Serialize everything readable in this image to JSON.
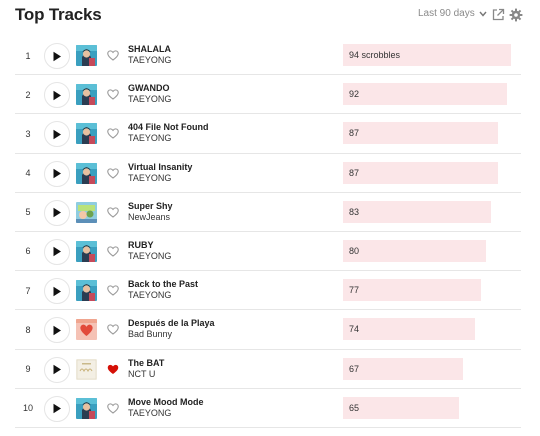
{
  "header": {
    "title": "Top Tracks",
    "period_label": "Last 90 days",
    "period_icon": "chevron-down-icon",
    "share_icon": "share-icon",
    "settings_icon": "gear-icon"
  },
  "colors": {
    "bar_fill": "#fbe6e8",
    "loved_heart": "#d51007",
    "text_primary": "#222222",
    "text_muted": "#8a8a8a"
  },
  "tracks": [
    {
      "rank": "1",
      "title": "SHALALA",
      "artist": "TAEYONG",
      "scrobbles": "94 scrobbles",
      "count": 94,
      "loved": false,
      "art": "taeyong"
    },
    {
      "rank": "2",
      "title": "GWANDO",
      "artist": "TAEYONG",
      "scrobbles": "92",
      "count": 92,
      "loved": false,
      "art": "taeyong"
    },
    {
      "rank": "3",
      "title": "404 File Not Found",
      "artist": "TAEYONG",
      "scrobbles": "87",
      "count": 87,
      "loved": false,
      "art": "taeyong"
    },
    {
      "rank": "4",
      "title": "Virtual Insanity",
      "artist": "TAEYONG",
      "scrobbles": "87",
      "count": 87,
      "loved": false,
      "art": "taeyong"
    },
    {
      "rank": "5",
      "title": "Super Shy",
      "artist": "NewJeans",
      "scrobbles": "83",
      "count": 83,
      "loved": false,
      "art": "newjeans"
    },
    {
      "rank": "6",
      "title": "RUBY",
      "artist": "TAEYONG",
      "scrobbles": "80",
      "count": 80,
      "loved": false,
      "art": "taeyong"
    },
    {
      "rank": "7",
      "title": "Back to the Past",
      "artist": "TAEYONG",
      "scrobbles": "77",
      "count": 77,
      "loved": false,
      "art": "taeyong"
    },
    {
      "rank": "8",
      "title": "Después de la Playa",
      "artist": "Bad Bunny",
      "scrobbles": "74",
      "count": 74,
      "loved": false,
      "art": "badbunny"
    },
    {
      "rank": "9",
      "title": "The BAT",
      "artist": "NCT U",
      "scrobbles": "67",
      "count": 67,
      "loved": true,
      "art": "nctu"
    },
    {
      "rank": "10",
      "title": "Move Mood Mode",
      "artist": "TAEYONG",
      "scrobbles": "65",
      "count": 65,
      "loved": false,
      "art": "taeyong"
    }
  ]
}
